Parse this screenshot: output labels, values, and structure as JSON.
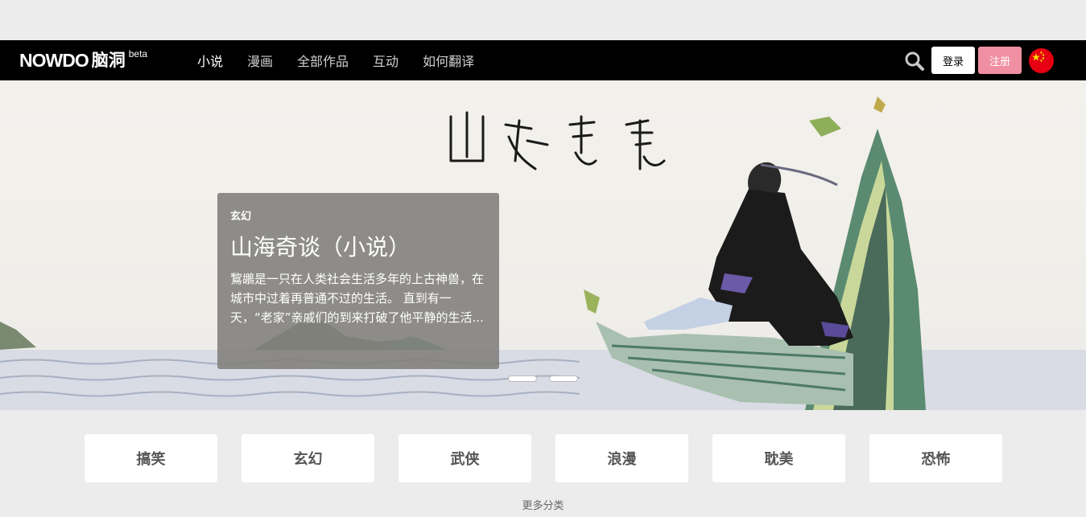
{
  "navbar": {
    "logo_mark": "NOWDO",
    "logo_cn": "脑洞",
    "logo_beta": "beta",
    "links": [
      "小说",
      "漫画",
      "全部作品",
      "互动",
      "如何翻译"
    ],
    "active_link": "小说",
    "login_label": "登录",
    "register_label": "注册",
    "search_icon": "search-icon",
    "language_flag": "china-flag-icon"
  },
  "banner": {
    "calligraphy_title": "山海奇谈",
    "card": {
      "genre": "玄幻",
      "title": "山海奇谈（小说）",
      "description": "鵹鶘是一只在人类社会生活多年的上古神兽，在城市中过着再普通不过的生活。 直到有一天，“老家”亲戚们的到来打破了他平静的生活..."
    },
    "slide_count": 2
  },
  "genres": [
    "搞笑",
    "玄幻",
    "武侠",
    "浪漫",
    "耽美",
    "恐怖"
  ],
  "more_label": "更多分类",
  "colors": {
    "navbar_bg": "#000000",
    "register_bg": "#f08fa2",
    "page_bg": "#ececec",
    "card_bg": "#807e7b"
  }
}
